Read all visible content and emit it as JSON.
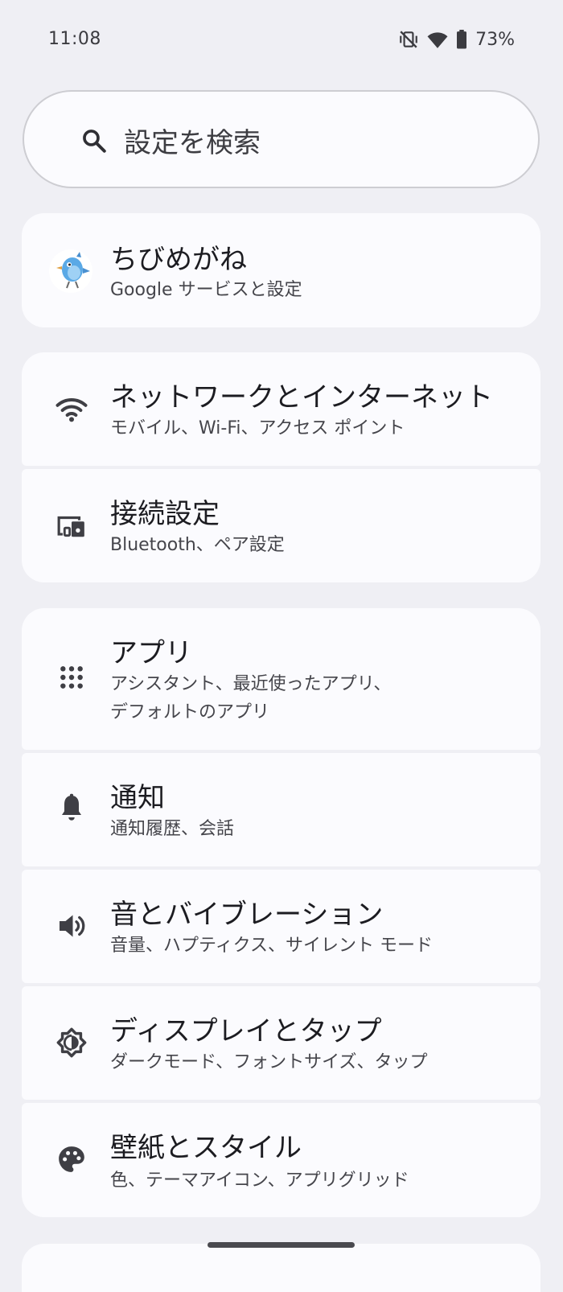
{
  "status_bar": {
    "time": "11:08",
    "battery": "73%",
    "icons": [
      "mute-vibrate-icon",
      "wifi-icon",
      "battery-icon"
    ]
  },
  "search": {
    "placeholder": "設定を検索"
  },
  "account": {
    "name": "ちびめがね",
    "subtitle": "Google サービスと設定"
  },
  "items": [
    {
      "title": "ネットワークとインターネット",
      "subtitle": "モバイル、Wi-Fi、アクセス ポイント",
      "icon": "wifi-icon"
    },
    {
      "title": "接続設定",
      "subtitle": "Bluetooth、ペア設定",
      "icon": "connected-devices-icon"
    },
    {
      "title": "アプリ",
      "subtitle_line1": "アシスタント、最近使ったアプリ、",
      "subtitle_line2": "デフォルトのアプリ",
      "icon": "apps-grid-icon"
    },
    {
      "title": "通知",
      "subtitle": "通知履歴、会話",
      "icon": "bell-icon"
    },
    {
      "title": "音とバイブレーション",
      "subtitle": "音量、ハプティクス、サイレント モード",
      "icon": "volume-icon"
    },
    {
      "title": "ディスプレイとタップ",
      "subtitle": "ダークモード、フォントサイズ、タップ",
      "icon": "brightness-icon"
    },
    {
      "title": "壁紙とスタイル",
      "subtitle": "色、テーマアイコン、アプリグリッド",
      "icon": "palette-icon"
    }
  ],
  "colors": {
    "background": "#efeff4",
    "card": "#fbfbfe",
    "icon": "#3f3f45"
  }
}
